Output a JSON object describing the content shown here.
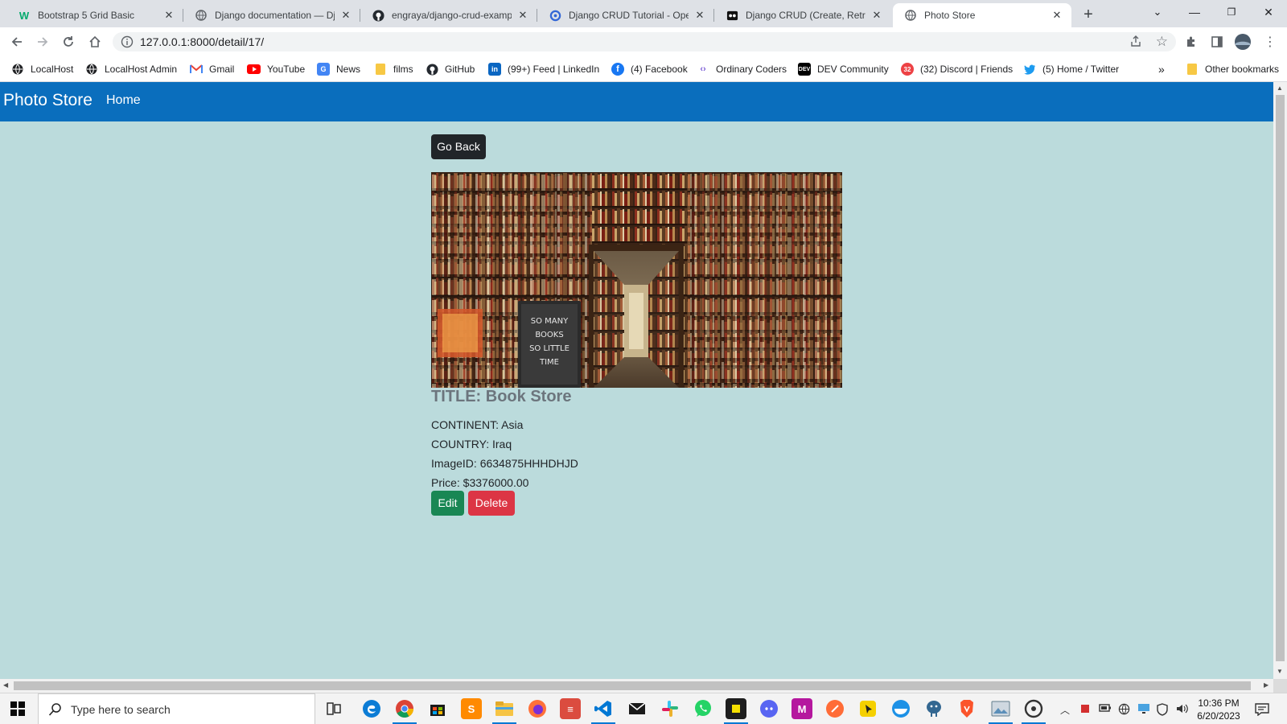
{
  "browser": {
    "tabs": [
      {
        "title": "Bootstrap 5 Grid Basic",
        "icon": "w3schools-icon",
        "active": false
      },
      {
        "title": "Django documentation — Dja",
        "icon": "globe-icon",
        "active": false
      },
      {
        "title": "engraya/django-crud-exampl",
        "icon": "github-icon",
        "active": false
      },
      {
        "title": "Django CRUD Tutorial - Oper",
        "icon": "opengenus-icon",
        "active": false
      },
      {
        "title": "Django CRUD (Create, Retriev",
        "icon": "film-icon",
        "active": false
      },
      {
        "title": "Photo Store",
        "icon": "globe-icon",
        "active": true
      }
    ],
    "url": "127.0.0.1:8000/detail/17/",
    "bookmarks": [
      {
        "label": "LocalHost",
        "icon": "globe-icon"
      },
      {
        "label": "LocalHost Admin",
        "icon": "globe-icon"
      },
      {
        "label": "Gmail",
        "icon": "gmail-icon"
      },
      {
        "label": "YouTube",
        "icon": "youtube-icon"
      },
      {
        "label": "News",
        "icon": "news-icon"
      },
      {
        "label": "films",
        "icon": "folder-icon"
      },
      {
        "label": "GitHub",
        "icon": "github-icon"
      },
      {
        "label": "(99+) Feed | LinkedIn",
        "icon": "linkedin-icon"
      },
      {
        "label": "(4) Facebook",
        "icon": "facebook-icon"
      },
      {
        "label": "Ordinary Coders",
        "icon": "code-icon"
      },
      {
        "label": "DEV Community",
        "icon": "dev-icon"
      },
      {
        "label": "(32) Discord | Friends",
        "icon": "discord-icon"
      },
      {
        "label": "(5) Home / Twitter",
        "icon": "twitter-icon"
      }
    ],
    "other_bookmarks": "Other bookmarks",
    "overflow_glyph": "»"
  },
  "page": {
    "brand": "Photo Store",
    "nav_home": "Home",
    "go_back": "Go Back",
    "photo_text": [
      "SO MANY",
      "BOOKS",
      "SO LITTLE",
      "TIME"
    ],
    "title": "TITLE: Book Store",
    "fields": [
      "CONTINENT: Asia",
      "COUNTRY: Iraq",
      "ImageID: 6634875HHHDHJD",
      "Price: $3376000.00"
    ],
    "edit": "Edit",
    "delete": "Delete",
    "colors": {
      "navbar": "#0a6ebd",
      "background": "#bbdbdc",
      "edit": "#198754",
      "delete": "#dc3545",
      "go_back": "#212529"
    }
  },
  "taskbar": {
    "search_placeholder": "Type here to search",
    "time": "10:36 PM",
    "date": "6/20/2023",
    "apps": [
      "task-view-icon",
      "edge-icon",
      "chrome-icon",
      "store-icon",
      "sublime-icon",
      "file-explorer-icon",
      "firefox-icon",
      "todoist-icon",
      "vscode-icon",
      "mail-icon",
      "slack-icon",
      "whatsapp-icon",
      "app-icon",
      "discord-icon",
      "m-icon",
      "postman-icon",
      "cursor-icon",
      "docker-icon",
      "postgres-icon",
      "brave-icon",
      "image-viewer-icon",
      "obs-icon"
    ]
  }
}
